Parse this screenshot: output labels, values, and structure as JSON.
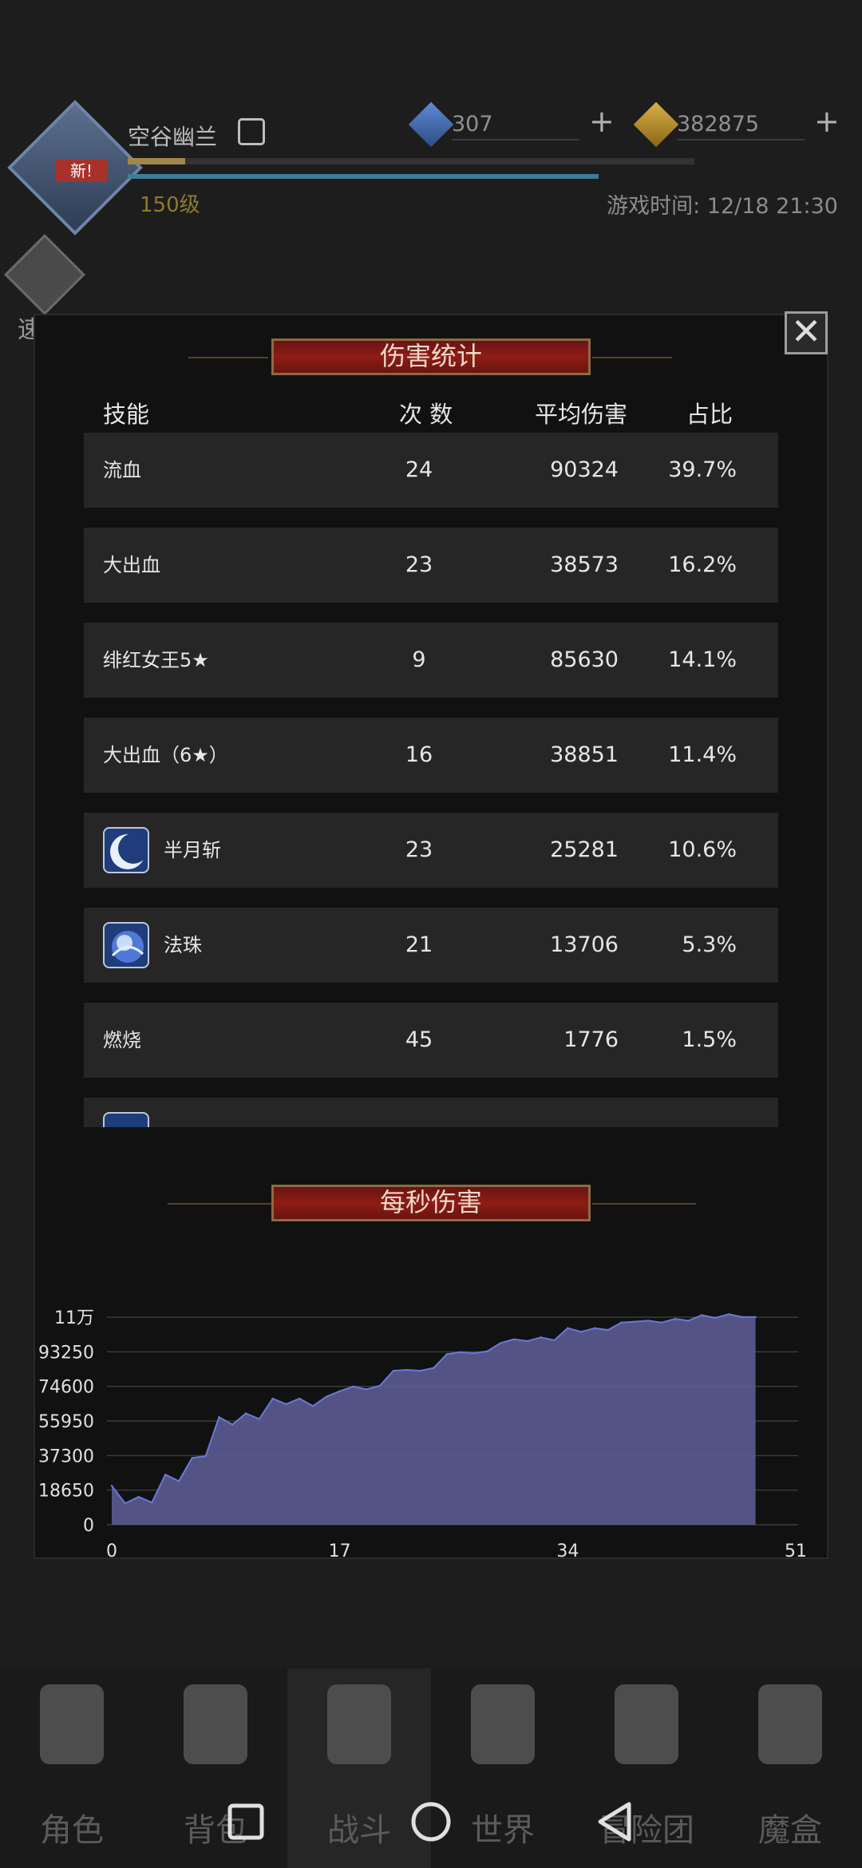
{
  "player": {
    "name": "空谷幽兰",
    "badge": "新!",
    "level": "150级",
    "game_time": "游戏时间: 12/18 21:30"
  },
  "resources": {
    "gems": "307",
    "gold": "382875"
  },
  "quick": {
    "label": "速战"
  },
  "damage": {
    "title": "伤害统计",
    "columns": {
      "skill": "技能",
      "count": "次 数",
      "avg": "平均伤害",
      "pct": "占比"
    },
    "rows": [
      {
        "skill": "流血",
        "count": "24",
        "avg": "90324",
        "pct": "39.7%",
        "icon": ""
      },
      {
        "skill": "大出血",
        "count": "23",
        "avg": "38573",
        "pct": "16.2%",
        "icon": ""
      },
      {
        "skill": "绯红女王5★",
        "count": "9",
        "avg": "85630",
        "pct": "14.1%",
        "icon": ""
      },
      {
        "skill": "大出血（6★）",
        "count": "16",
        "avg": "38851",
        "pct": "11.4%",
        "icon": ""
      },
      {
        "skill": "半月斩",
        "count": "23",
        "avg": "25281",
        "pct": "10.6%",
        "icon": "crescent-moon-icon"
      },
      {
        "skill": "法珠",
        "count": "21",
        "avg": "13706",
        "pct": "5.3%",
        "icon": "orb-icon"
      },
      {
        "skill": "燃烧",
        "count": "45",
        "avg": "1776",
        "pct": "1.5%",
        "icon": ""
      }
    ]
  },
  "dps": {
    "title": "每秒伤害"
  },
  "chart_data": {
    "type": "area",
    "title": "每秒伤害",
    "x": [
      0,
      1,
      2,
      3,
      4,
      5,
      6,
      7,
      8,
      9,
      10,
      11,
      12,
      13,
      14,
      15,
      16,
      17,
      18,
      19,
      20,
      21,
      22,
      23,
      24,
      25,
      26,
      27,
      28,
      29,
      30,
      31,
      32,
      33,
      34,
      35,
      36,
      37,
      38,
      39,
      40,
      41,
      42,
      43,
      44,
      45,
      46,
      47,
      48
    ],
    "values": [
      21000,
      11500,
      15000,
      12000,
      27000,
      23500,
      36000,
      37000,
      58000,
      54000,
      60000,
      57000,
      68000,
      65000,
      68000,
      64000,
      69000,
      72000,
      74500,
      73000,
      75000,
      83000,
      83500,
      83000,
      84500,
      92000,
      93000,
      92500,
      93500,
      98000,
      100000,
      99000,
      101000,
      99500,
      106000,
      104000,
      106000,
      105000,
      109000,
      109500,
      110000,
      109000,
      111000,
      110000,
      113000,
      111500,
      113500,
      112000,
      112000
    ],
    "xticks": [
      "0",
      "17",
      "34",
      "51"
    ],
    "yticks": [
      "11万",
      "93250",
      "74600",
      "55950",
      "37300",
      "18650",
      "0"
    ],
    "xlim": [
      0,
      51
    ],
    "ylim": [
      0,
      111900
    ],
    "grid": true,
    "color": "#5b5c92",
    "line_color": "#6a78d8"
  },
  "nav": {
    "items": [
      "角色",
      "背包",
      "战斗",
      "世界",
      "冒险团",
      "魔盒"
    ],
    "active": 2
  }
}
